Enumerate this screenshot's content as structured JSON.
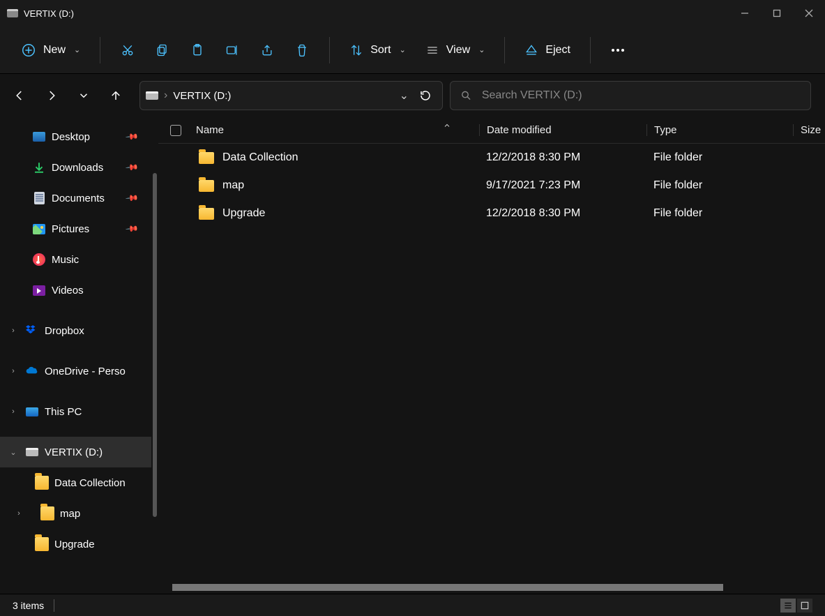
{
  "window": {
    "title": "VERTIX (D:)"
  },
  "toolbar": {
    "new_label": "New",
    "sort_label": "Sort",
    "view_label": "View",
    "eject_label": "Eject"
  },
  "address": {
    "crumb": "VERTIX (D:)"
  },
  "search": {
    "placeholder": "Search VERTIX (D:)"
  },
  "sidebar": {
    "quick": [
      {
        "label": "Desktop",
        "pinned": true
      },
      {
        "label": "Downloads",
        "pinned": true
      },
      {
        "label": "Documents",
        "pinned": true
      },
      {
        "label": "Pictures",
        "pinned": true
      },
      {
        "label": "Music",
        "pinned": false
      },
      {
        "label": "Videos",
        "pinned": false
      }
    ],
    "cloud": [
      {
        "label": "Dropbox"
      },
      {
        "label": "OneDrive - Perso"
      }
    ],
    "pc": {
      "label": "This PC"
    },
    "drive": {
      "label": "VERTIX (D:)",
      "children": [
        {
          "label": "Data Collection"
        },
        {
          "label": "map"
        },
        {
          "label": "Upgrade"
        }
      ]
    }
  },
  "columns": {
    "name": "Name",
    "date": "Date modified",
    "type": "Type",
    "size": "Size"
  },
  "files": [
    {
      "name": "Data Collection",
      "date": "12/2/2018 8:30 PM",
      "type": "File folder"
    },
    {
      "name": "map",
      "date": "9/17/2021 7:23 PM",
      "type": "File folder"
    },
    {
      "name": "Upgrade",
      "date": "12/2/2018 8:30 PM",
      "type": "File folder"
    }
  ],
  "status": {
    "text": "3 items"
  }
}
